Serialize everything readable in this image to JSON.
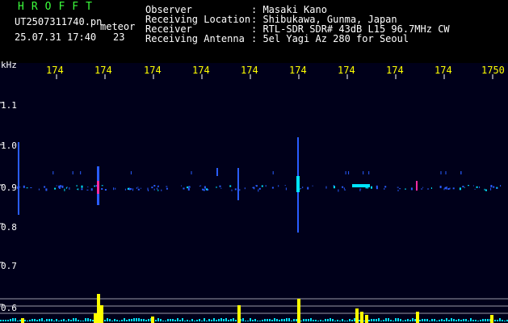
{
  "header": {
    "brand": "HROFFT",
    "filename": "UT2507311740.pn",
    "mode": "meteor",
    "timestamp": "25.07.31 17:40",
    "count": "23",
    "fields": [
      {
        "label": "Observer",
        "value": ": Masaki Kano"
      },
      {
        "label": "Receiving Location",
        "value": ": Shibukawa, Gunma, Japan"
      },
      {
        "label": "Receiver",
        "value": ": RTL-SDR SDR# 43dB L15 96.7MHz CW"
      },
      {
        "label": "Receiving Antenna",
        "value": ": 5el Yagi Az 280 for Seoul"
      }
    ]
  },
  "axis": {
    "unit": "kHz",
    "time_labels": [
      "174",
      "174",
      "174",
      "174",
      "174",
      "174",
      "174",
      "174",
      "174",
      "1750"
    ],
    "freq_labels": [
      "1.1",
      "1.0",
      "0.9",
      "0.8",
      "0.7",
      "0.6"
    ]
  },
  "colors": {
    "background": "#00001a",
    "label_yellow": "#ffff00",
    "title_green": "#3cff3c",
    "signal_blue": "#2a5cff",
    "signal_cyan": "#00e5ff",
    "signal_magenta": "#ff2aa0",
    "meter_yellow": "#ffff00"
  }
}
